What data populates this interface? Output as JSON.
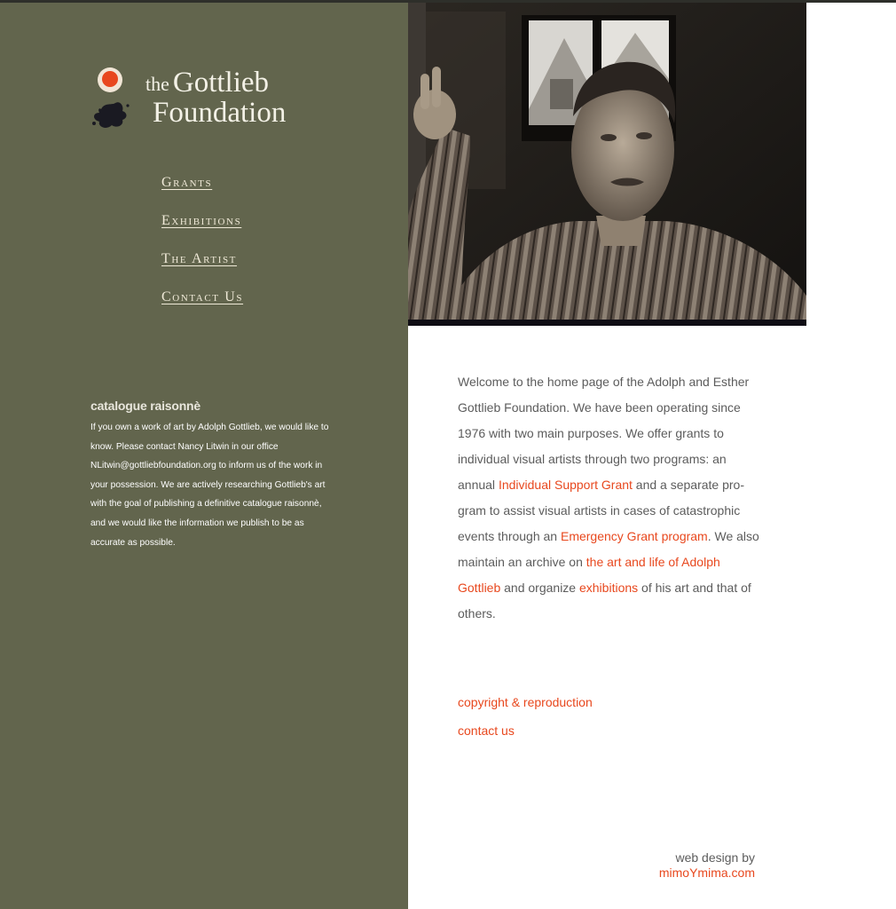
{
  "logo": {
    "line1_small": "the",
    "line1_large": "Gottlieb",
    "line2": "Foundation"
  },
  "nav": [
    {
      "label": "Grants"
    },
    {
      "label": "Exhibitions"
    },
    {
      "label": "The Artist"
    },
    {
      "label": "Contact Us"
    }
  ],
  "catalogue": {
    "heading": "catalogue raisonnè",
    "text": "If you own a work of art by Adolph Gottlieb, we would like to know. Please contact Nancy Litwin in our office NLitwin@gottliebfoundation.org  to inform us of the work in your possession. We are actively researching Gottlieb's art with the goal of publishing a definitive catalogue raisonnè, and we would like the information we publish to be as accurate as possible."
  },
  "intro": {
    "part1": "Welcome to the home page of the Adolph and Esther Gottlieb Foundation. We have been operating since 1976 with two main purposes. We offer grants to individual visual artists through two programs: an annual ",
    "link1": "Individual Support Grant",
    "part2": " and a separate pro-gram to assist visual artists in cases of catastrophic events through an ",
    "link2": "Emergency Grant program",
    "part3": ". We also maintain an archive on ",
    "link3": "the art and life of Adolph Gottlieb",
    "part4": " and organize ",
    "link4": "exhibitions",
    "part5": " of his art and that of others."
  },
  "links": {
    "copyright": "copyright & reproduction",
    "contact": "contact us"
  },
  "credit": {
    "line1": "web design by",
    "link": "mimoYmima.com"
  },
  "colors": {
    "sidebar": "#62654d",
    "accent": "#e8481e",
    "text": "#5c5c5c"
  }
}
